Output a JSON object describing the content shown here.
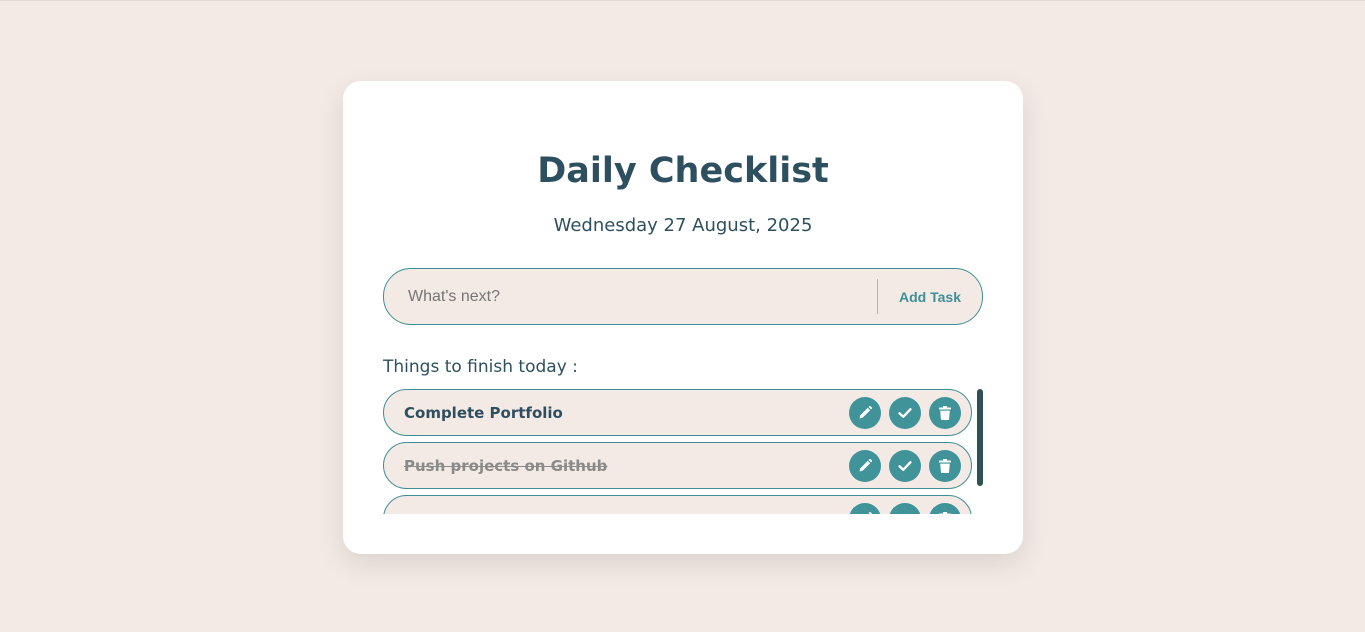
{
  "app": {
    "title": "Daily Checklist",
    "date": "Wednesday 27 August, 2025"
  },
  "input": {
    "value": "",
    "placeholder": "What's next?",
    "add_label": "Add Task"
  },
  "list": {
    "heading": "Things to finish today :",
    "tasks": [
      {
        "text": "Complete Portfolio",
        "completed": false
      },
      {
        "text": "Push projects on Github",
        "completed": true
      },
      {
        "text": "",
        "completed": false
      }
    ]
  },
  "icons": {
    "edit": "pencil-icon",
    "complete": "check-icon",
    "delete": "trash-icon"
  },
  "colors": {
    "background": "#f3eae5",
    "card": "#ffffff",
    "primary_text": "#2d4f5f",
    "accent": "#3f8f96",
    "scrollbar": "#2e5254"
  }
}
